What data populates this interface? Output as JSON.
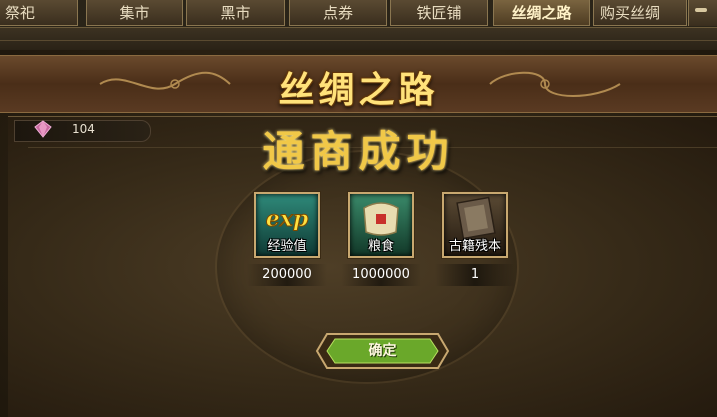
{
  "tabs": [
    "祭祀",
    "集市",
    "黑市",
    "点券",
    "铁匠铺",
    "丝绸之路",
    "购买丝绸"
  ],
  "active_tab": "丝绸之路",
  "banner": {
    "title": "丝绸之路"
  },
  "currency": {
    "icon": "gem-icon",
    "value": "104"
  },
  "result": {
    "title": "通商成功"
  },
  "rewards": [
    {
      "name": "经验值",
      "icon": "exp-icon",
      "quantity": "200000"
    },
    {
      "name": "粮食",
      "icon": "grain-sack-icon",
      "quantity": "1000000"
    },
    {
      "name": "古籍残本",
      "icon": "ancient-book-icon",
      "quantity": "1"
    }
  ],
  "confirm_button": {
    "label": "确定"
  },
  "colors": {
    "accent_gold": "#f0c848",
    "button_green": "#6aa82a",
    "frame": "#c8a870"
  }
}
